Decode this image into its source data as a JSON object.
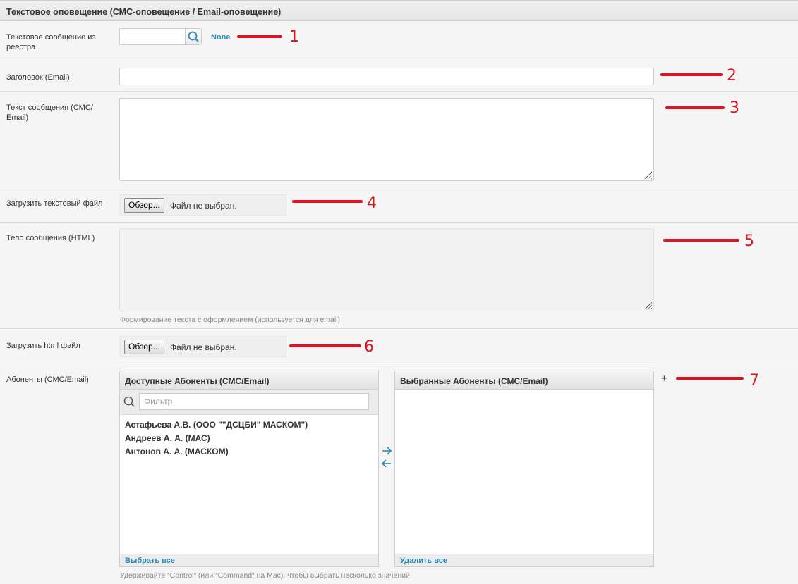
{
  "section": {
    "title": "Текстовое оповещение (СМС-оповещение / Email-оповещение)"
  },
  "fields": {
    "registry_label": "Текстовое сообщение из реестра",
    "registry_value": "None",
    "subject_label": "Заголовок (Email)",
    "body_label": "Текст сообщения (СМС/ Email)",
    "upload_text_label": "Загрузить текстовый файл",
    "upload_text_button": "Обзор...",
    "upload_text_status": "Файл не выбран.",
    "html_label": "Тело сообщения (HTML)",
    "html_hint": "Формирование текста с оформлением (используется для email)",
    "upload_html_label": "Загрузить html файл",
    "upload_html_button": "Обзор...",
    "upload_html_status": "Файл не выбран.",
    "subscribers_label": "Абоненты (СМС/Email)"
  },
  "selector": {
    "available_title": "Доступные Абоненты (СМС/Email)",
    "filter_placeholder": "Фильтр",
    "available_items": [
      "Астафьева А.В. (ООО \"\"ДСЦБИ\" МАСКОМ\")",
      "Андреев А. А. (МАС)",
      "Антонов А. А. (МАСКОМ)"
    ],
    "choose_all": "Выбрать все",
    "chosen_title": "Выбранные Абоненты (СМС/Email)",
    "remove_all": "Удалить все",
    "add_symbol": "+",
    "hint": "Удерживайте “Control“ (или “Command“ на Mac), чтобы выбрать несколько значений."
  },
  "annotations": [
    "1",
    "2",
    "3",
    "4",
    "5",
    "6",
    "7"
  ],
  "colors": {
    "link": "#2a8ab8",
    "annotation": "#e0141f"
  },
  "icons": {
    "search": "search-icon",
    "arrow_right": "arrow-right-icon",
    "arrow_left": "arrow-left-icon"
  }
}
